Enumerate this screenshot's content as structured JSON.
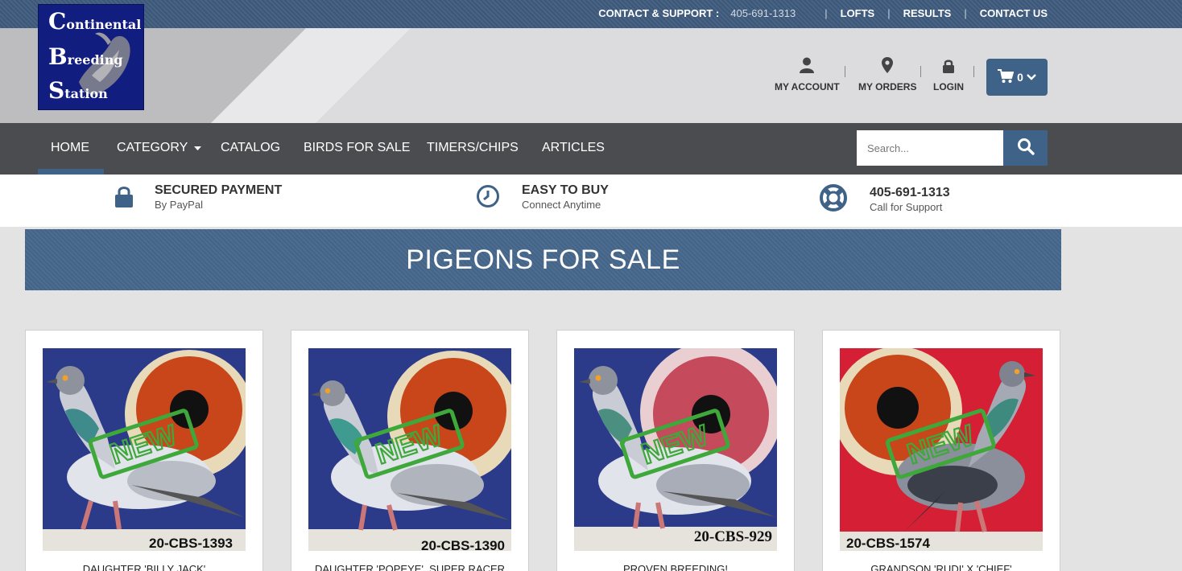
{
  "topbar": {
    "support_label": "CONTACT & SUPPORT :",
    "phone": "405-691-1313",
    "links": [
      "LOFTS",
      "RESULTS",
      "CONTACT US"
    ]
  },
  "logo": {
    "line1_cap": "C",
    "line1_rest": "ontinental",
    "line2_cap": "B",
    "line2_rest": "reeding",
    "line3_cap": "S",
    "line3_rest": "tation"
  },
  "account": {
    "my_account": "MY ACCOUNT",
    "my_orders": "MY ORDERS",
    "login": "LOGIN",
    "cart_count": "0"
  },
  "nav": {
    "items": [
      "HOME",
      "CATEGORY",
      "CATALOG",
      "BIRDS FOR SALE",
      "TIMERS/CHIPS",
      "ARTICLES"
    ],
    "search_placeholder": "Search..."
  },
  "features": [
    {
      "title": "SECURED PAYMENT",
      "subtitle": "By PayPal",
      "icon": "lock-icon"
    },
    {
      "title": "EASY TO BUY",
      "subtitle": "Connect Anytime",
      "icon": "clock-icon"
    },
    {
      "title": "405-691-1313",
      "subtitle": "Call for Support",
      "icon": "lifebuoy-icon"
    }
  ],
  "banner": {
    "title": "PIGEONS FOR SALE"
  },
  "products": [
    {
      "name": "DAUGHTER 'BILLY JACK'",
      "ring": "20-CBS-1393",
      "stamp": "NEW",
      "bg": "#2c3a8a",
      "eye": "#c8461a"
    },
    {
      "name": "DAUGHTER 'POPEYE', SUPER RACER",
      "ring": "20-CBS-1390",
      "stamp": "NEW",
      "bg": "#2c3a8a",
      "eye": "#c8461a"
    },
    {
      "name": "PROVEN BREEDING!",
      "ring": "20-CBS-929",
      "stamp": "NEW",
      "bg": "#2c3a8a",
      "eye": "#c44a5c"
    },
    {
      "name": "GRANDSON 'RUDI' X 'CHIEF'",
      "ring": "20-CBS-1574",
      "stamp": "NEW",
      "bg": "#d41f35",
      "eye": "#c8461a"
    }
  ],
  "colors": {
    "topbar": "#3e5b7d",
    "nav": "#4a4c4f",
    "accent": "#3f6388",
    "banner": "#46678c"
  }
}
